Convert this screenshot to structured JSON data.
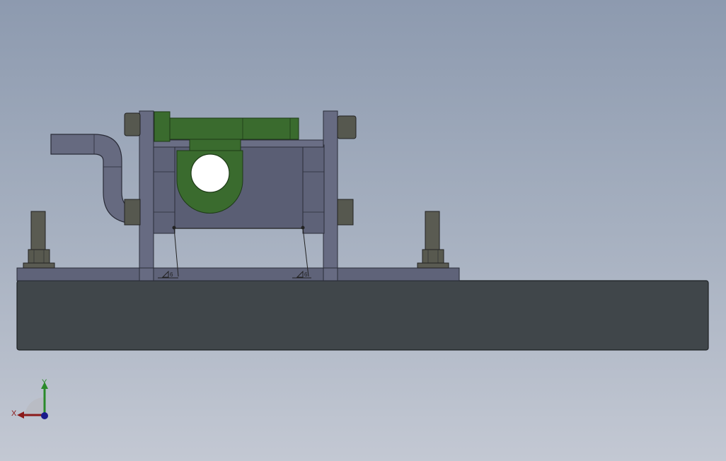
{
  "viewport": {
    "background_top": "#8d9aaf",
    "background_bottom": "#c3c8d3"
  },
  "model": {
    "parts": [
      "base-plate",
      "frame-plate",
      "left-upright",
      "right-upright",
      "green-clamp-arm",
      "center-block",
      "pipe",
      "locating-pin-left",
      "locating-pin-right"
    ],
    "colors": {
      "base": "#40464a",
      "frame": "#5f6379",
      "upright": "#676b82",
      "clamp": "#3a6b2e",
      "pipe": "#666a80",
      "hardware": "#55584e"
    },
    "weld_labels": [
      "6",
      "6"
    ]
  },
  "triad": {
    "x_label": "X",
    "y_label": "Y",
    "x_color": "#8b1a1a",
    "y_color": "#2a8a2a",
    "z_color": "#1a1a8b"
  }
}
